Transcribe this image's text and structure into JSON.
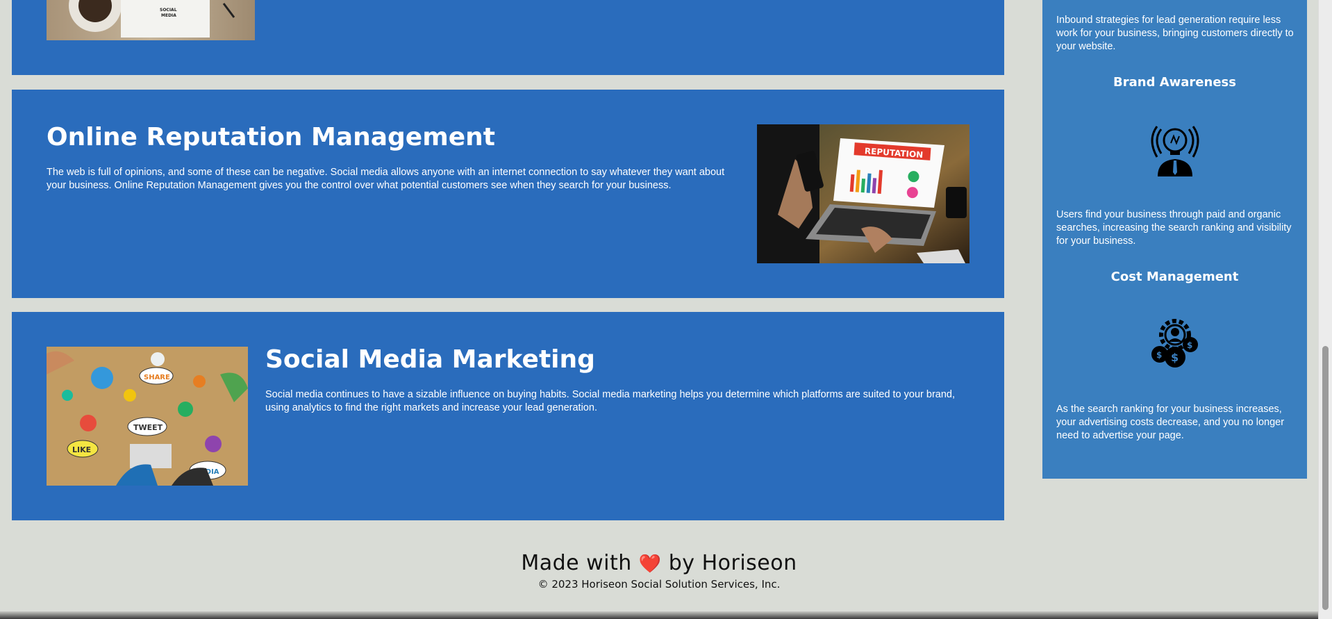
{
  "sections": {
    "top": {
      "image_alt": "social media notebook with coffee"
    },
    "reputation": {
      "title": "Online Reputation Management",
      "body": "The web is full of opinions, and some of these can be negative. Social media allows anyone with an internet connection to say whatever they want about your business. Online Reputation Management gives you the control over what potential customers see when they search for your business.",
      "image_text": "REPUTATION"
    },
    "smm": {
      "title": "Social Media Marketing",
      "body": "Social media continues to have a sizable influence on buying habits. Social media marketing helps you determine which platforms are suited to your brand, using analytics to find the right markets and increase your lead generation.",
      "image_words": [
        "SHARE",
        "TWEET",
        "LIKE",
        "MEDIA"
      ]
    }
  },
  "sidebar": {
    "lead_text": "Inbound strategies for lead generation require less work for your business, bringing customers directly to your website.",
    "brand": {
      "title": "Brand Awareness",
      "icon": "lightbulb-head-icon",
      "text": "Users find your business through paid and organic searches, increasing the search ranking and visibility for your business."
    },
    "cost": {
      "title": "Cost Management",
      "icon": "money-gear-icon",
      "text": "As the search ranking for your business increases, your advertising costs decrease, and you no longer need to advertise your page."
    }
  },
  "footer": {
    "made_with": "Made with",
    "by": "by Horiseon",
    "copyright": "© 2023 Horiseon Social Solution Services, Inc."
  },
  "colors": {
    "card_blue": "#2a6cbc",
    "sidebar_blue": "#3a7fbf",
    "page_bg": "#d9dcd6"
  }
}
